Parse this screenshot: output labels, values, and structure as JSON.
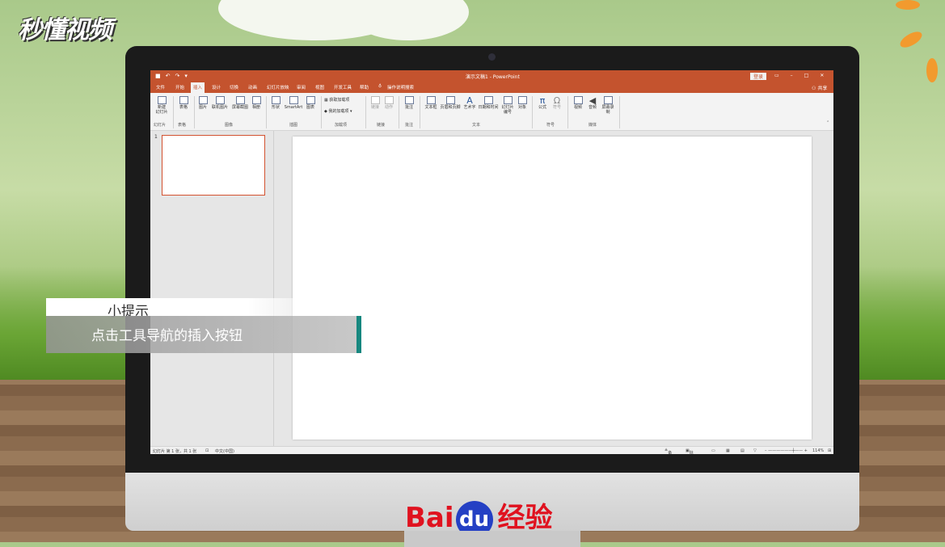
{
  "brand_logo": "秒懂视频",
  "window": {
    "title": "演示文稿1 - PowerPoint",
    "login_label": "登录",
    "share_label": "共享",
    "accent_color": "#c4532e"
  },
  "tabs": [
    {
      "label": "文件"
    },
    {
      "label": "开始"
    },
    {
      "label": "插入"
    },
    {
      "label": "设计"
    },
    {
      "label": "切换"
    },
    {
      "label": "动画"
    },
    {
      "label": "幻灯片放映"
    },
    {
      "label": "审阅"
    },
    {
      "label": "视图"
    },
    {
      "label": "开发工具"
    },
    {
      "label": "帮助"
    },
    {
      "label": "操作说明搜索"
    }
  ],
  "active_tab": "插入",
  "ribbon": {
    "buttons": [
      {
        "label": "新建\n幻灯片"
      },
      {
        "label": "表格"
      },
      {
        "label": "图片"
      },
      {
        "label": "联机图片"
      },
      {
        "label": "屏幕截图"
      },
      {
        "label": "相册"
      },
      {
        "label": "形状"
      },
      {
        "label": "SmartArt"
      },
      {
        "label": "图表"
      },
      {
        "label": "获取加载项"
      },
      {
        "label": "我的加载项"
      },
      {
        "label": "链接"
      },
      {
        "label": "动作"
      },
      {
        "label": "批注"
      },
      {
        "label": "文本框"
      },
      {
        "label": "页眉和页脚"
      },
      {
        "label": "艺术字"
      },
      {
        "label": "日期和时间"
      },
      {
        "label": "幻灯片编号"
      },
      {
        "label": "对象"
      },
      {
        "label": "公式"
      },
      {
        "label": "符号"
      },
      {
        "label": "视频"
      },
      {
        "label": "音频"
      },
      {
        "label": "屏幕录制"
      }
    ],
    "groups": [
      {
        "label": "幻灯片"
      },
      {
        "label": "表格"
      },
      {
        "label": "图像"
      },
      {
        "label": "插图"
      },
      {
        "label": "加载项"
      },
      {
        "label": "链接"
      },
      {
        "label": "批注"
      },
      {
        "label": "文本"
      },
      {
        "label": "符号"
      },
      {
        "label": "媒体"
      }
    ]
  },
  "thumbnail_number": "1",
  "status": {
    "slide_info": "幻灯片 第 1 张，共 1 张",
    "language": "中文(中国)",
    "notes": "备注",
    "comments": "批注",
    "zoom": "114%"
  },
  "tip": {
    "title": "小提示",
    "text": "点击工具导航的插入按钮",
    "bar_color": "#17877f"
  },
  "footer_logo": {
    "bai": "Bai",
    "du": "du",
    "jingyan": "经验"
  }
}
